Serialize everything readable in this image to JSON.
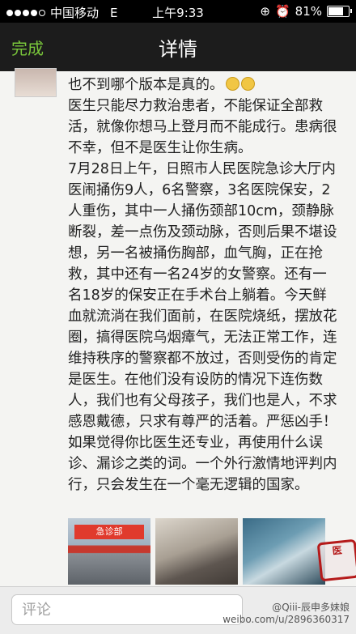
{
  "status_bar": {
    "carrier": "中国移动",
    "network": "E",
    "time": "上午9:33",
    "battery_text": "81%",
    "battery_level": 0.81
  },
  "nav": {
    "done_label": "完成",
    "title": "详情"
  },
  "post": {
    "paragraphs": [
      "也不到哪个版本是真的。",
      "医生只能尽力救治患者，不能保证全部救活，就像你想马上登月而不能成行。患病很不幸，但不是医生让你生病。",
      "7月28日上午，日照市人民医院急诊大厅内医闹捅伤9人，6名警察，3名医院保安，2人重伤，其中一人捅伤颈部10cm，颈静脉断裂，差一点伤及颈动脉，否则后果不堪设想，另一名被捅伤胸部，血气胸，正在抢救，其中还有一名24岁的女警察。还有一名18岁的保安正在手术台上躺着。今天鲜血就流淌在我们面前，在医院烧纸，摆放花圈，搞得医院乌烟瘴气，无法正常工作，连维持秩序的警察都不放过，否则受伤的肯定是医生。在他们没有设防的情况下连伤数人，我们也有父母孩子，我们也是人，不求感恩戴德，只求有尊严的活着。严惩凶手！",
      "如果觉得你比医生还专业，再使用什么误诊、漏诊之类的词。一个外行激情地评判内行，只会发生在一个毫无逻辑的国家。"
    ],
    "photo_sign": "急诊部",
    "seal_text": "医"
  },
  "bottom": {
    "comment_placeholder": "评论",
    "weibo_handle": "@Qiii-辰申多妹娘",
    "weibo_url": "weibo.com/u/2896360317"
  }
}
